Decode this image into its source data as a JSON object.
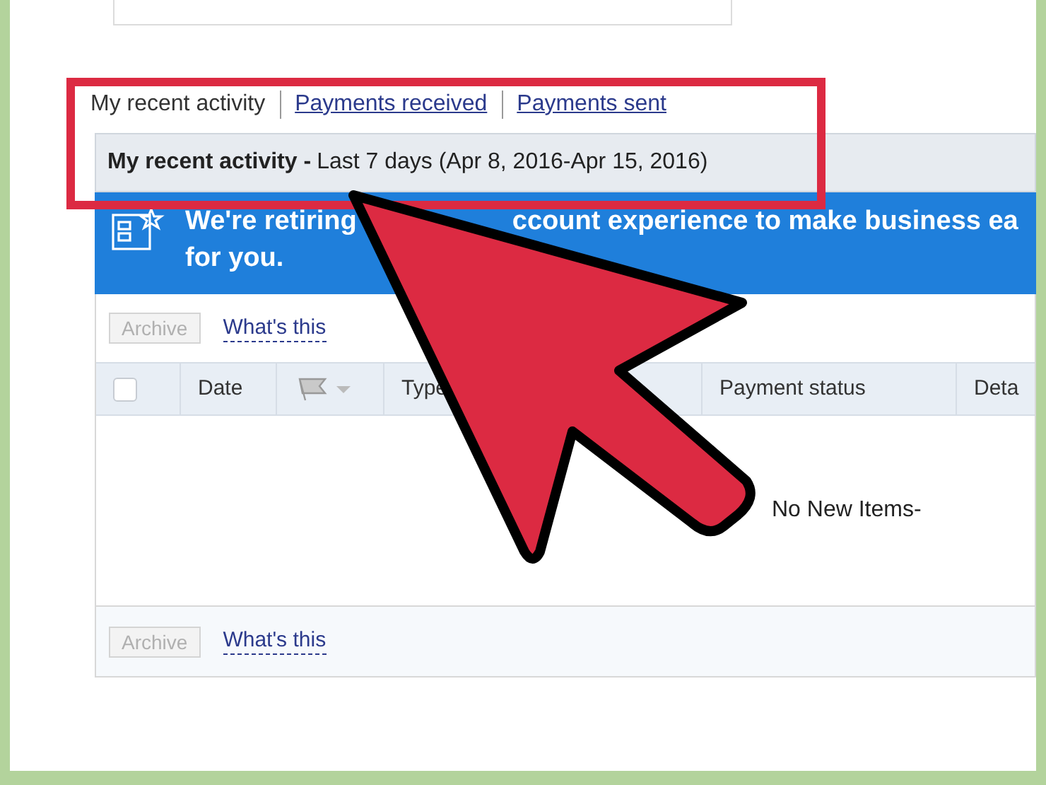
{
  "tabs": [
    {
      "label": "My recent activity",
      "selected": true
    },
    {
      "label": "Payments received",
      "selected": false
    },
    {
      "label": "Payments sent",
      "selected": false
    }
  ],
  "header": {
    "title": "My recent activity -",
    "range": "Last 7 days (Apr 8, 2016-Apr 15, 2016)"
  },
  "banner": {
    "text_start": "We're retiring",
    "text_end": "ccount experience to make business ea",
    "line_2": "for you."
  },
  "toolbar_top": {
    "archive": {
      "label": "Archive",
      "disabled": true
    },
    "help_link": "What's this"
  },
  "columns": [
    {
      "kind": "checkbox",
      "checked": false
    },
    {
      "kind": "text",
      "label": "Date"
    },
    {
      "kind": "flag"
    },
    {
      "kind": "text",
      "label": "Type"
    },
    {
      "kind": "blank"
    },
    {
      "kind": "text",
      "label": "Payment status"
    },
    {
      "kind": "text",
      "label": "Deta"
    }
  ],
  "empty_message": "No New Items-",
  "toolbar_bottom": {
    "archive": {
      "label": "Archive",
      "disabled": true
    },
    "help_link": "What's this"
  }
}
